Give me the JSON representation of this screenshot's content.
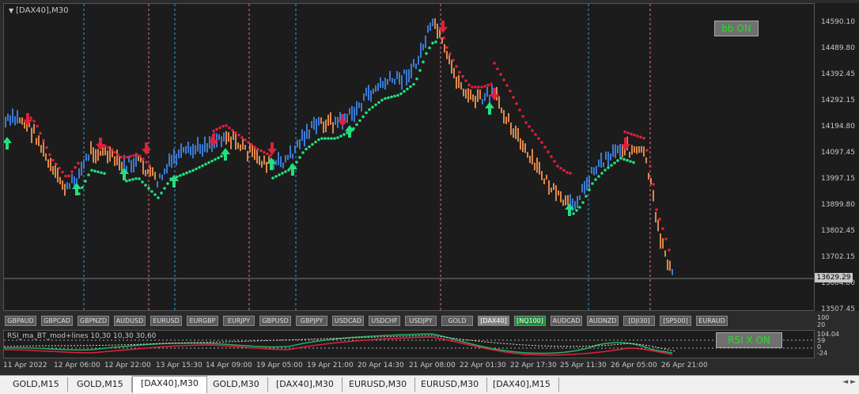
{
  "chart": {
    "symbol_label": "[DAX40],M30",
    "bb_button": "bb ON",
    "rsi_button": "RSI X ON",
    "rsi_label": "RSI_ma_BT_mod+lines 10,30 10,30 30,60",
    "current_price": "13629.29",
    "price_labels": [
      "14590.10",
      "14489.80",
      "14392.45",
      "14292.15",
      "14194.80",
      "14097.45",
      "13997.15",
      "13899.80",
      "13802.45",
      "13702.15",
      "13604.80",
      "13507.45"
    ],
    "rsi_labels": [
      "104.04",
      "59",
      "0",
      "-24"
    ],
    "pair_axis_labels": [
      "100",
      "20"
    ],
    "time_labels": [
      "11 Apr 2022",
      "12 Apr 06:00",
      "12 Apr 22:00",
      "13 Apr 15:30",
      "14 Apr 09:00",
      "19 Apr 05:00",
      "19 Apr 21:00",
      "20 Apr 14:30",
      "21 Apr 08:00",
      "22 Apr 01:30",
      "22 Apr 17:30",
      "25 Apr 11:30",
      "26 Apr 05:00",
      "26 Apr 21:00"
    ],
    "colors": {
      "bull": "#3a7bd5",
      "bear": "#e0884a",
      "up_arrow": "#22e080",
      "down_arrow": "#e0203c",
      "vline_blue": "#2aa0e0",
      "vline_pink": "#e07090"
    }
  },
  "pairs": [
    {
      "label": "GBPAUD",
      "state": "normal"
    },
    {
      "label": "GBPCAD",
      "state": "normal"
    },
    {
      "label": "GBPNZD",
      "state": "normal"
    },
    {
      "label": "AUDUSD",
      "state": "normal"
    },
    {
      "label": "EURUSD",
      "state": "normal"
    },
    {
      "label": "EURGBP",
      "state": "normal"
    },
    {
      "label": "EURJPY",
      "state": "normal"
    },
    {
      "label": "GBPUSD",
      "state": "normal"
    },
    {
      "label": "GBPJPY",
      "state": "normal"
    },
    {
      "label": "USDCAD",
      "state": "normal"
    },
    {
      "label": "USDCHF",
      "state": "normal"
    },
    {
      "label": "USDJPY",
      "state": "normal"
    },
    {
      "label": "GOLD",
      "state": "normal"
    },
    {
      "label": "[DAX40]",
      "state": "active"
    },
    {
      "label": "[NQ100]",
      "state": "green"
    },
    {
      "label": "AUDCAD",
      "state": "normal"
    },
    {
      "label": "AUDNZD",
      "state": "normal"
    },
    {
      "label": "[DJI30]",
      "state": "normal"
    },
    {
      "label": "[SP500]",
      "state": "normal"
    },
    {
      "label": "EURAUD",
      "state": "normal"
    }
  ],
  "tabs": [
    {
      "label": "GOLD,M15",
      "active": false
    },
    {
      "label": "GOLD,M15",
      "active": false
    },
    {
      "label": "[DAX40],M30",
      "active": true
    },
    {
      "label": "GOLD,M30",
      "active": false
    },
    {
      "label": "[DAX40],M30",
      "active": false
    },
    {
      "label": "EURUSD,M30",
      "active": false
    },
    {
      "label": "EURUSD,M30",
      "active": false
    },
    {
      "label": "[DAX40],M15",
      "active": false
    }
  ],
  "tab_nav": "◄ ►"
}
